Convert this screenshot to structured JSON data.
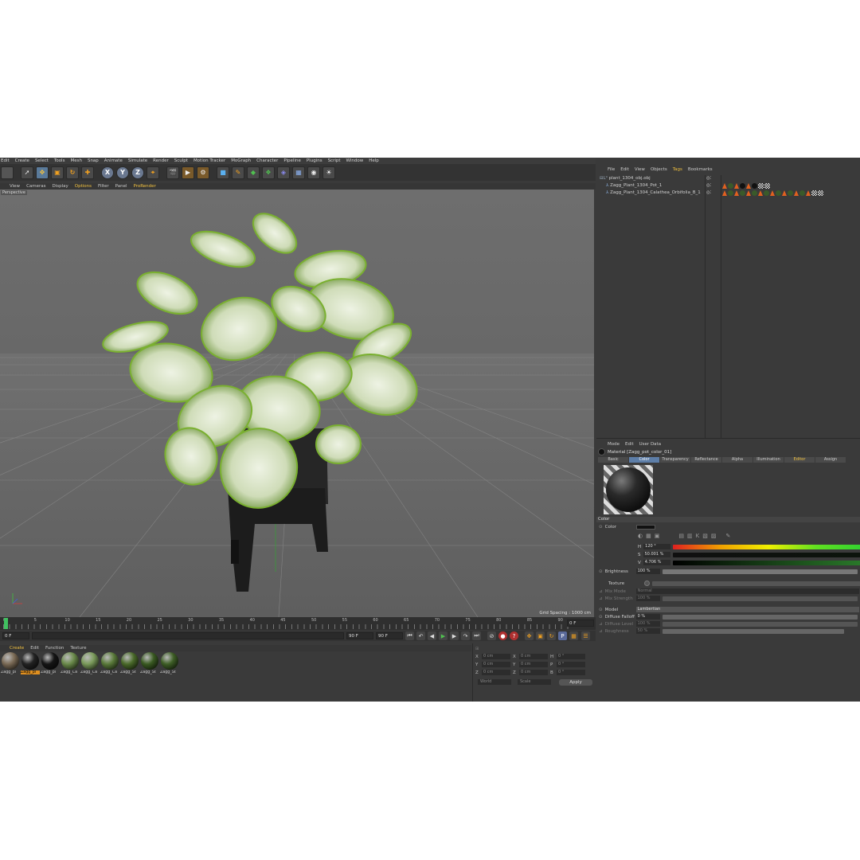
{
  "menubar": [
    "Edit",
    "Create",
    "Select",
    "Tools",
    "Mesh",
    "Snap",
    "Animate",
    "Simulate",
    "Render",
    "Sculpt",
    "Motion Tracker",
    "MoGraph",
    "Character",
    "Pipeline",
    "Plugins",
    "Script",
    "Window",
    "Help"
  ],
  "toolbar": {
    "x": "X",
    "y": "Y",
    "z": "Z"
  },
  "viewport_menu": [
    "View",
    "Cameras",
    "Display",
    "Options",
    "Filter",
    "Panel",
    "ProRender"
  ],
  "viewport": {
    "label": "Perspective",
    "grid_spacing": "Grid Spacing : 1000 cm"
  },
  "timeline": {
    "ticks": [
      "0",
      "5",
      "10",
      "15",
      "20",
      "25",
      "30",
      "35",
      "40",
      "45",
      "50",
      "55",
      "60",
      "65",
      "70",
      "75",
      "80",
      "85",
      "90"
    ],
    "current_frame": "0 F"
  },
  "playbar": {
    "start": "0 F",
    "end": "90 F",
    "end2": "90 F"
  },
  "material_menu": [
    "Create",
    "Edit",
    "Function",
    "Texture"
  ],
  "materials": [
    {
      "name": "Zagg_pl",
      "color": "#7a6a55"
    },
    {
      "name": "Zagg_pl",
      "color": "#222"
    },
    {
      "name": "Zagg_pl",
      "color": "#151515"
    },
    {
      "name": "Zagg_Ca",
      "color": "#6a8a4a"
    },
    {
      "name": "Zagg_Ca",
      "color": "#7a9a5a"
    },
    {
      "name": "Zagg_Ca",
      "color": "#5a7a3a"
    },
    {
      "name": "Zagg_St",
      "color": "#4a6a2a"
    },
    {
      "name": "Zagg_St",
      "color": "#3a5a22"
    },
    {
      "name": "Zagg_St",
      "color": "#3e5e26"
    }
  ],
  "coords": {
    "rows": [
      {
        "a": "X",
        "av": "0 cm",
        "b": "X",
        "bv": "0 cm",
        "c": "H",
        "cv": "0 °"
      },
      {
        "a": "Y",
        "av": "0 cm",
        "b": "Y",
        "bv": "0 cm",
        "c": "P",
        "cv": "0 °"
      },
      {
        "a": "Z",
        "av": "0 cm",
        "b": "Z",
        "bv": "0 cm",
        "c": "B",
        "cv": "0 °"
      }
    ],
    "world": "World",
    "scale": "Scale",
    "apply": "Apply"
  },
  "objects_menu": [
    "File",
    "Edit",
    "View",
    "Objects",
    "Tags",
    "Bookmarks"
  ],
  "objects": [
    "plant_1304_obj.obj",
    "Zagg_Plant_1304_Pot_1",
    "Zagg_Plant_1304_Calathea_Orbifolia_B_1"
  ],
  "attr_menu": [
    "Mode",
    "Edit",
    "User Data"
  ],
  "material_title": "Material [Zagg_pot_color_01]",
  "tabs": [
    "Basic",
    "Color",
    "Transparency",
    "Reflectance",
    "Alpha",
    "Illumination",
    "Editor",
    "Assign"
  ],
  "color_section": {
    "title": "Color",
    "color_label": "Color",
    "h_label": "H",
    "h_val": "120 °",
    "s_label": "S",
    "s_val": "50.001 %",
    "v_label": "V",
    "v_val": "4.706 %",
    "brightness_label": "Brightness",
    "brightness_val": "100 %",
    "texture_label": "Texture",
    "mix_mode_label": "Mix Mode",
    "mix_mode_val": "Normal",
    "mix_strength_label": "Mix Strength",
    "mix_strength_val": "100 %",
    "model_label": "Model",
    "model_val": "Lambertian",
    "diffuse_falloff_label": "Diffuse Falloff",
    "diffuse_falloff_val": "0 %",
    "diffuse_level_label": "Diffuse Level",
    "diffuse_level_val": "100 %",
    "roughness_label": "Roughness",
    "roughness_val": "50 %"
  },
  "colors": {
    "accent": "#f0c040",
    "tab_active": "#5d7ea8",
    "bg": "#3a3a3a",
    "viewport": "#6b6b6b"
  }
}
